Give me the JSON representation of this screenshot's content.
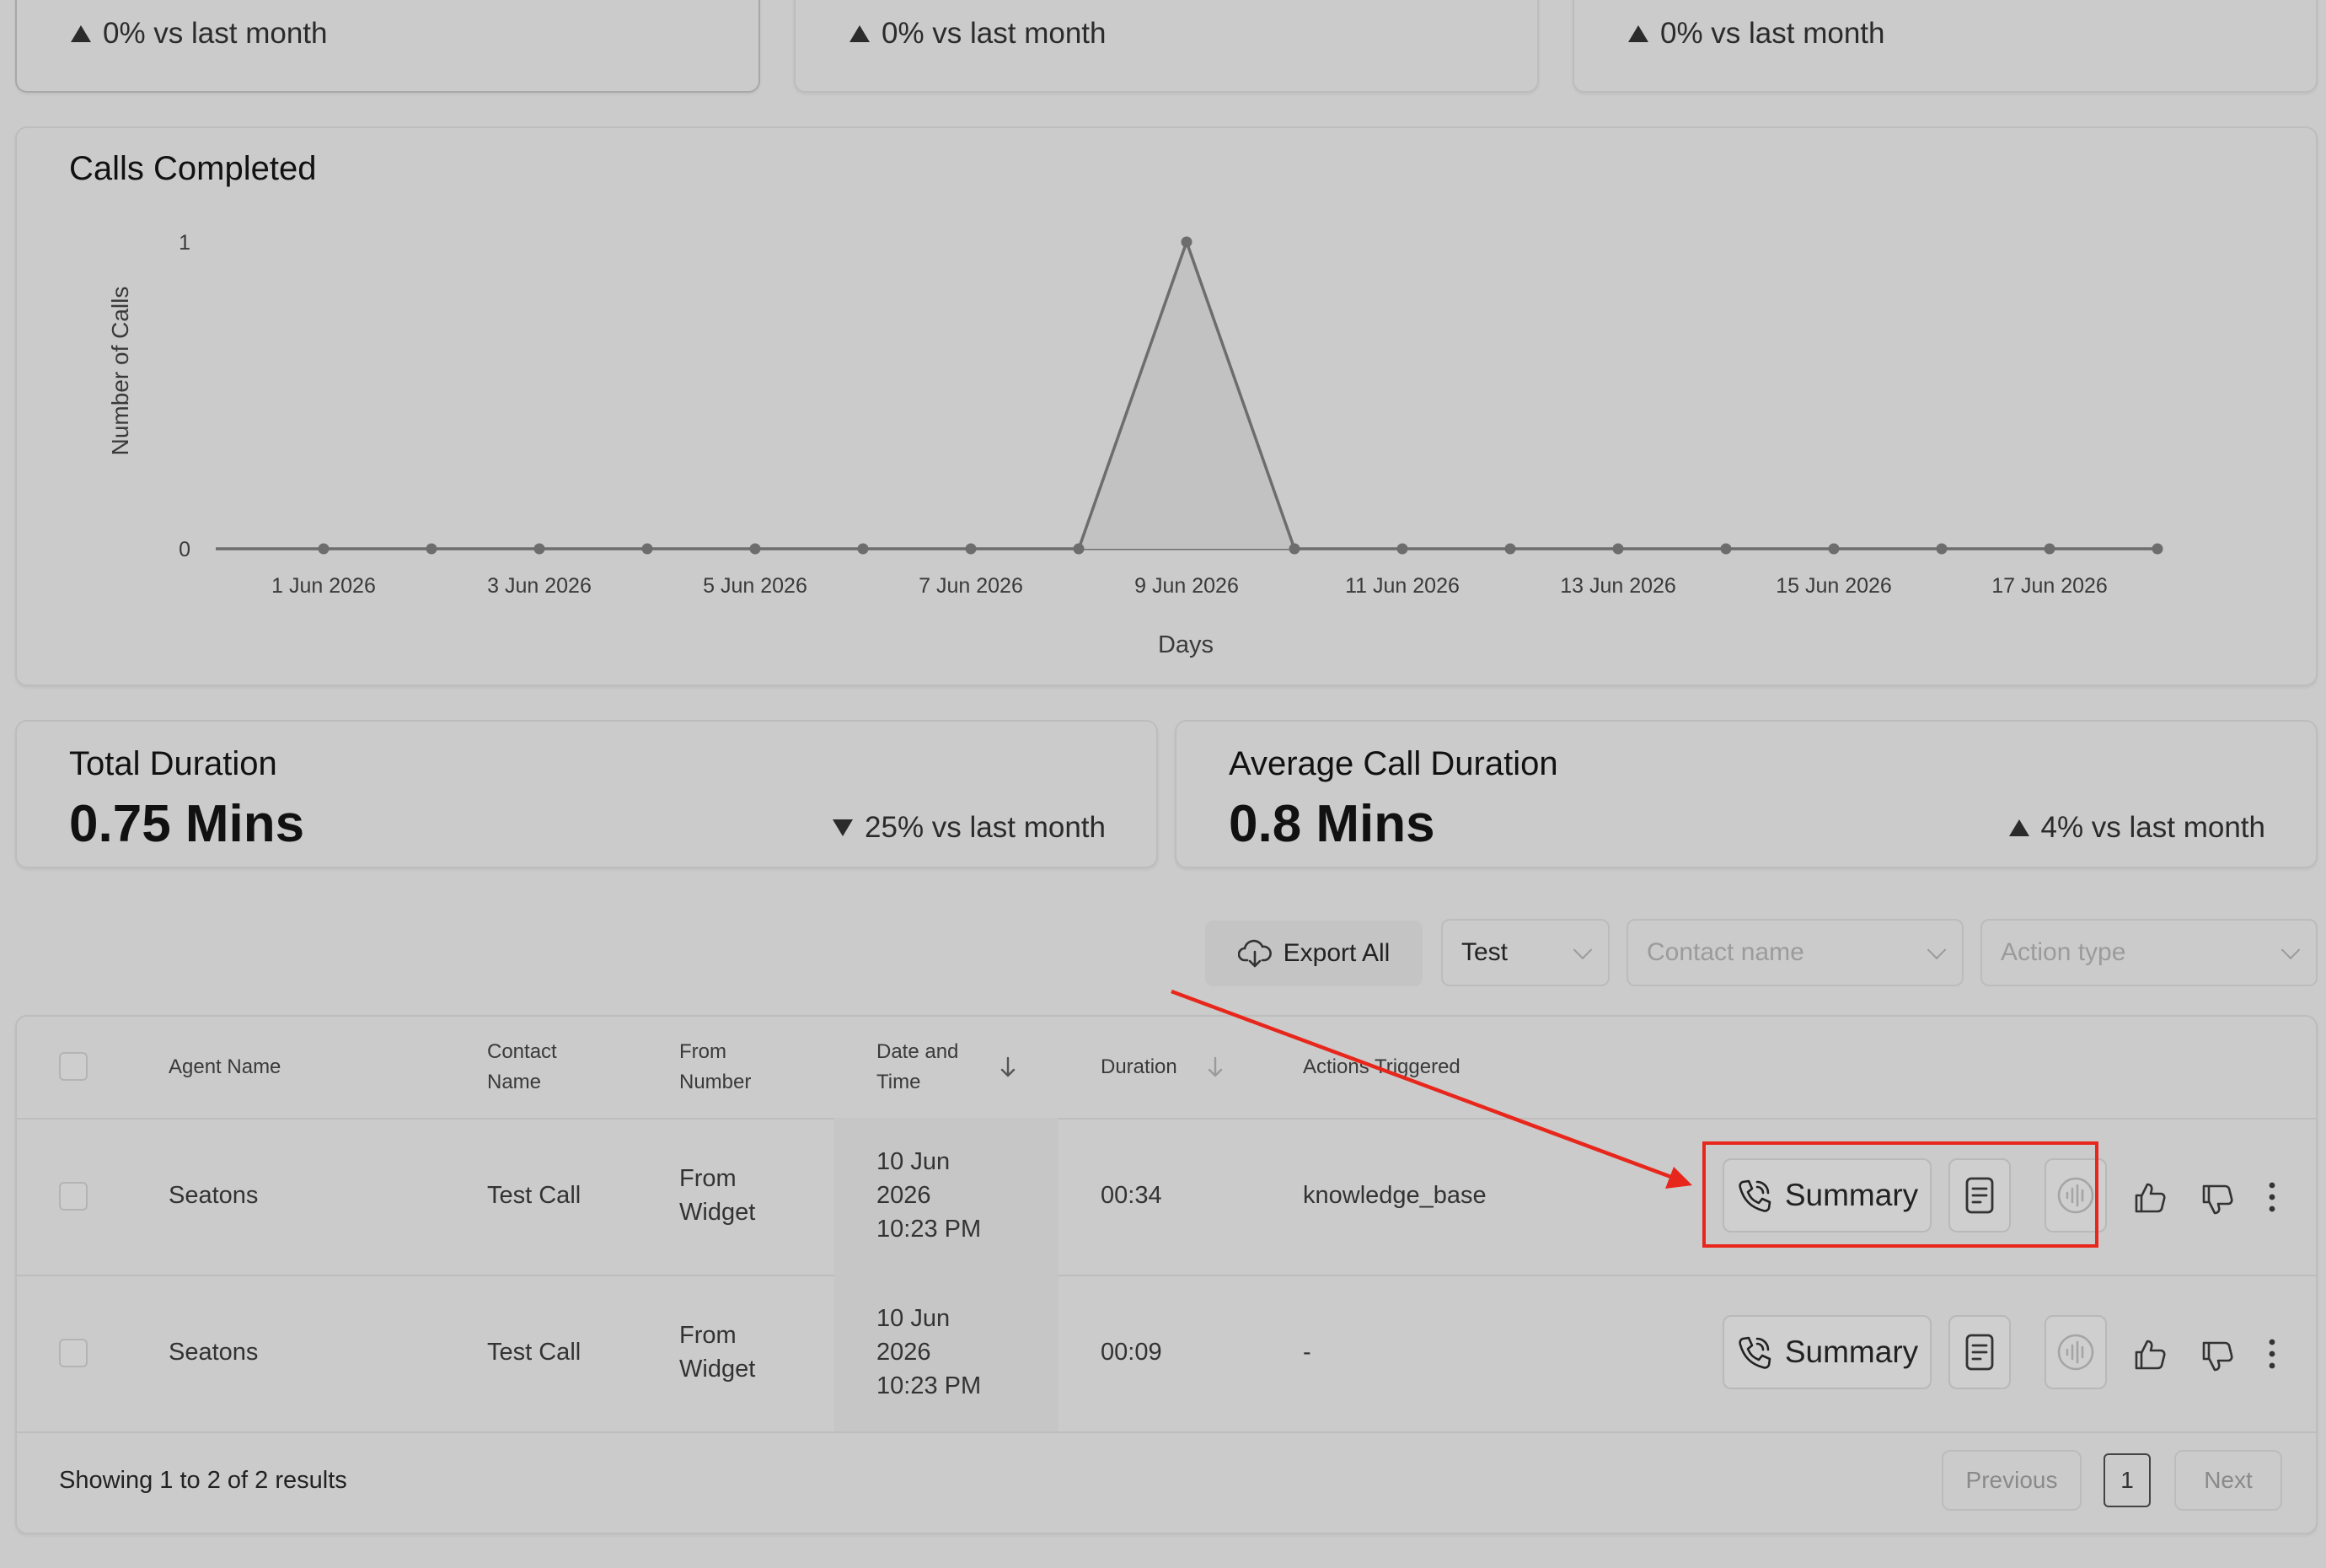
{
  "stat_cards_top": [
    {
      "trend": "0% vs last month",
      "direction": "up"
    },
    {
      "trend": "0% vs last month",
      "direction": "up"
    },
    {
      "trend": "0% vs last month",
      "direction": "up"
    }
  ],
  "calls_chart": {
    "title": "Calls Completed",
    "ylabel": "Number of Calls",
    "xlabel": "Days"
  },
  "chart_data": {
    "type": "line",
    "title": "Calls Completed",
    "xlabel": "Days",
    "ylabel": "Number of Calls",
    "x": [
      "31 May 2026",
      "1 Jun 2026",
      "2 Jun 2026",
      "3 Jun 2026",
      "4 Jun 2026",
      "5 Jun 2026",
      "6 Jun 2026",
      "7 Jun 2026",
      "8 Jun 2026",
      "9 Jun 2026",
      "10 Jun 2026",
      "11 Jun 2026",
      "12 Jun 2026",
      "13 Jun 2026",
      "14 Jun 2026",
      "15 Jun 2026",
      "16 Jun 2026",
      "17 Jun 2026",
      "18 Jun 2026"
    ],
    "values": [
      0,
      0,
      0,
      0,
      0,
      0,
      0,
      0,
      0,
      1,
      0,
      0,
      0,
      0,
      0,
      0,
      0,
      0,
      0
    ],
    "tick_labels": [
      "1 Jun 2026",
      "3 Jun 2026",
      "5 Jun 2026",
      "7 Jun 2026",
      "9 Jun 2026",
      "11 Jun 2026",
      "13 Jun 2026",
      "15 Jun 2026",
      "17 Jun 2026"
    ],
    "yticks": [
      "0",
      "1"
    ],
    "ylim": [
      0,
      1
    ],
    "grid": false,
    "legend": "none"
  },
  "total_duration": {
    "title": "Total Duration",
    "value": "0.75 Mins",
    "trend": "25% vs last month",
    "direction": "down"
  },
  "avg_duration": {
    "title": "Average Call Duration",
    "value": "0.8 Mins",
    "trend": "4% vs last month",
    "direction": "up"
  },
  "filters": {
    "export_label": "Export All",
    "agent_select": "Test",
    "contact_placeholder": "Contact name",
    "action_placeholder": "Action type"
  },
  "table": {
    "headers": {
      "agent": "Agent Name",
      "contact_1": "Contact",
      "contact_2": "Name",
      "from_1": "From",
      "from_2": "Number",
      "date_1": "Date and",
      "date_2": "Time",
      "duration": "Duration",
      "actions": "Actions Triggered"
    },
    "rows": [
      {
        "agent": "Seatons",
        "contact": "Test Call",
        "from_1": "From",
        "from_2": "Widget",
        "date_1": "10 Jun",
        "date_2": "2026",
        "date_3": "10:23 PM",
        "duration": "00:34",
        "actions": "knowledge_base",
        "summary": "Summary"
      },
      {
        "agent": "Seatons",
        "contact": "Test Call",
        "from_1": "From",
        "from_2": "Widget",
        "date_1": "10 Jun",
        "date_2": "2026",
        "date_3": "10:23 PM",
        "duration": "00:09",
        "actions": "-",
        "summary": "Summary"
      }
    ]
  },
  "pagination": {
    "summary": "Showing 1 to 2 of 2 results",
    "previous": "Previous",
    "page": "1",
    "next": "Next"
  },
  "colors": {
    "highlight": "#e8271c",
    "arrow": "#e8271c"
  }
}
